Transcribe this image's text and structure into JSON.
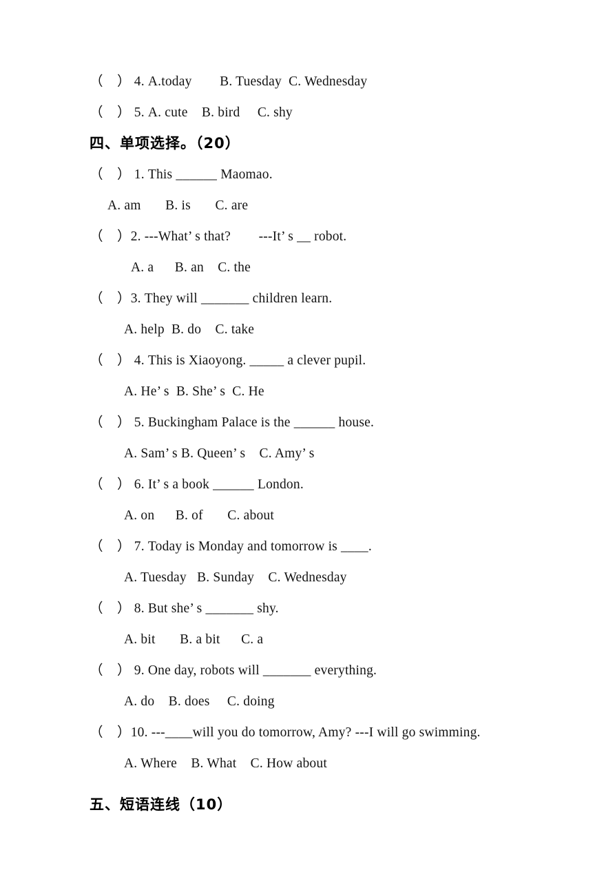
{
  "page": {
    "background_color": "#ffffff",
    "text_color": "#131313"
  },
  "carry_over_items": [
    "（    ） 4. A.today        B. Tuesday  C. Wednesday",
    "（    ） 5. A. cute    B. bird     C. shy"
  ],
  "sections": [
    {
      "id": "section-four",
      "heading": "四、单项选择。（20）",
      "score": "20",
      "questions": [
        {
          "number": "1",
          "stem": "（    ） 1. This ______ Maomao.",
          "options": "A. am       B. is       C. are",
          "option_indent": "indent-sm"
        },
        {
          "number": "2",
          "stem": "（    ）2. ---What’ s that?        ---It’ s __ robot.",
          "options": "A. a      B. an    C. the",
          "option_indent": "indent-lg"
        },
        {
          "number": "3",
          "stem": "（    ）3. They will _______ children learn.",
          "options": "A. help  B. do    C. take",
          "option_indent": ""
        },
        {
          "number": "4",
          "stem": "（    ） 4. This is Xiaoyong. _____ a clever pupil.",
          "options": "A. He’ s  B. She’ s  C. He",
          "option_indent": ""
        },
        {
          "number": "5",
          "stem": "（    ） 5. Buckingham Palace is the ______ house.",
          "options": "A. Sam’ s B. Queen’ s    C. Amy’ s",
          "option_indent": ""
        },
        {
          "number": "6",
          "stem": "（    ） 6. It’ s a book ______ London.",
          "options": "A. on      B. of       C. about",
          "option_indent": ""
        },
        {
          "number": "7",
          "stem": "（    ） 7. Today is Monday and tomorrow is ____.",
          "options": "A. Tuesday   B. Sunday    C. Wednesday",
          "option_indent": ""
        },
        {
          "number": "8",
          "stem": "（    ） 8. But she’ s _______ shy.",
          "options": "A. bit       B. a bit      C. a",
          "option_indent": ""
        },
        {
          "number": "9",
          "stem": "（    ） 9. One day, robots will _______ everything.",
          "options": "A. do    B. does     C. doing",
          "option_indent": ""
        },
        {
          "number": "10",
          "stem": "（    ）10. ---____will you do tomorrow, Amy? ---I will go swimming.",
          "options": "A. Where    B. What    C. How about",
          "option_indent": ""
        }
      ]
    },
    {
      "id": "section-five",
      "heading": "五、短语连线（10）",
      "score": "10",
      "questions": []
    }
  ]
}
